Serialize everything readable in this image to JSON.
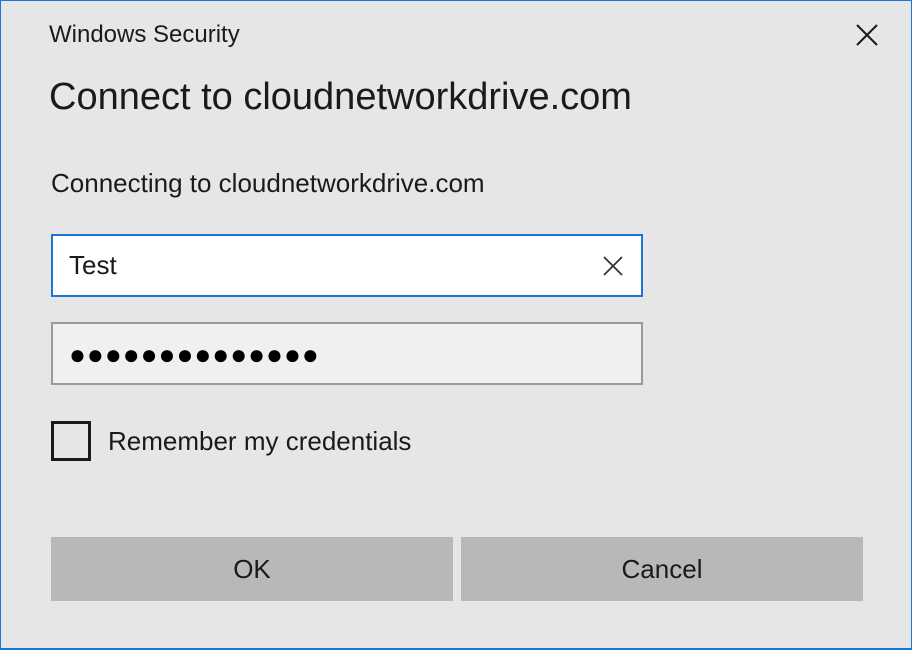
{
  "window": {
    "title": "Windows Security",
    "close_icon": "close-icon"
  },
  "dialog": {
    "heading": "Connect to cloudnetworkdrive.com",
    "subtext": "Connecting to cloudnetworkdrive.com"
  },
  "username": {
    "value": "Test",
    "clear_icon": "clear-icon"
  },
  "password": {
    "masked_value": "●●●●●●●●●●●●●●"
  },
  "remember": {
    "label": "Remember my credentials",
    "checked": false
  },
  "buttons": {
    "ok_label": "OK",
    "cancel_label": "Cancel"
  },
  "colors": {
    "accent": "#1a78d4",
    "background": "#e6e6e6",
    "button": "#b8b8b8"
  }
}
